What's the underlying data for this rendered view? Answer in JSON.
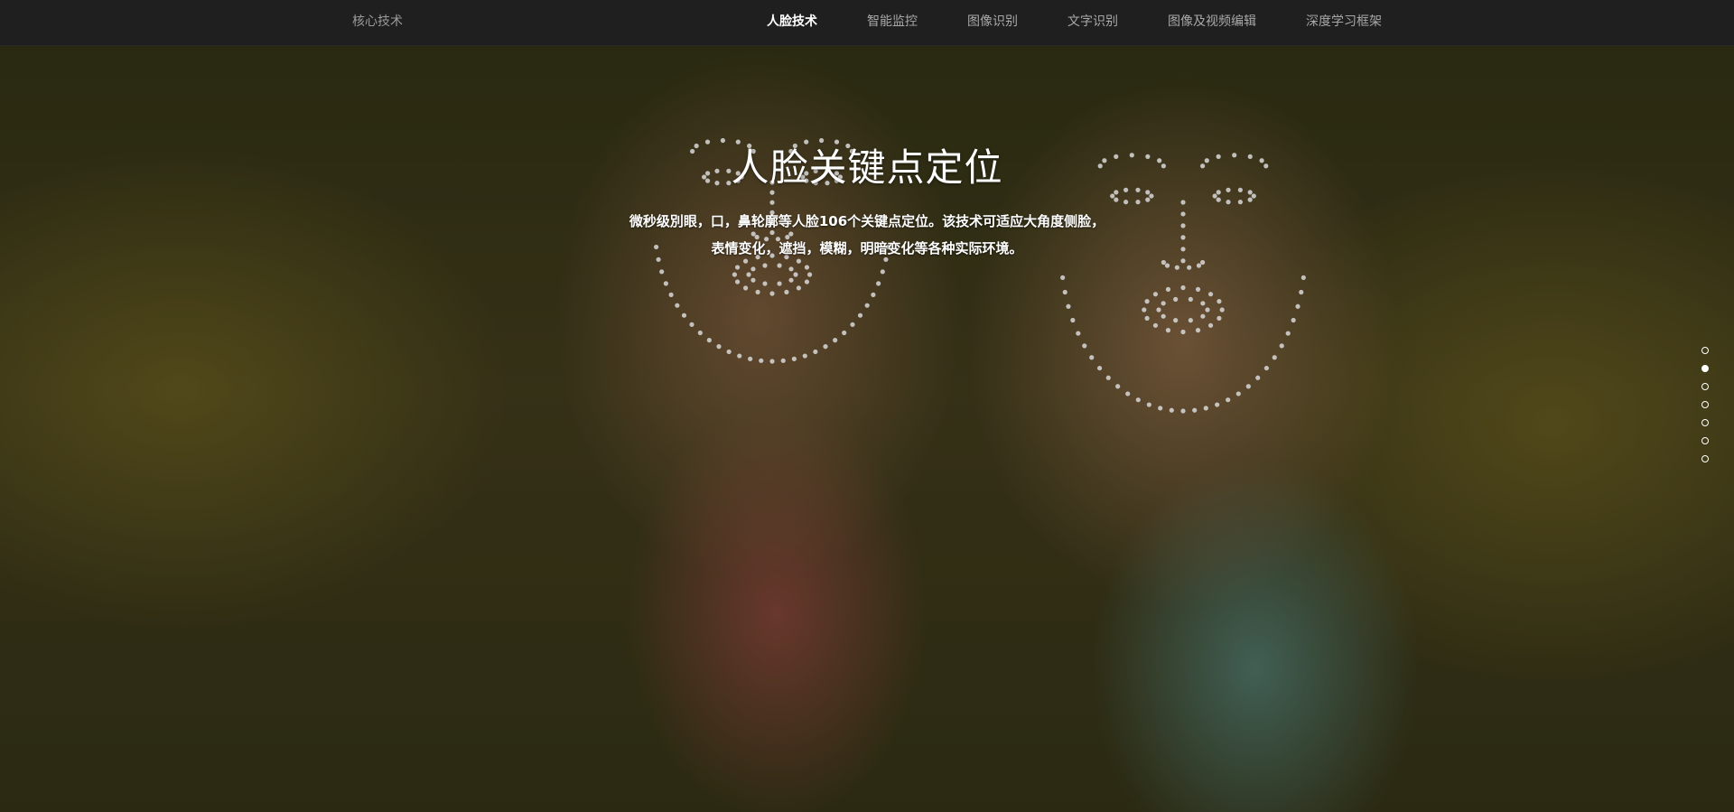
{
  "header": {
    "brand": "核心技术",
    "nav": [
      {
        "label": "人脸技术",
        "active": true
      },
      {
        "label": "智能监控",
        "active": false
      },
      {
        "label": "图像识别",
        "active": false
      },
      {
        "label": "文字识别",
        "active": false
      },
      {
        "label": "图像及视频编辑",
        "active": false
      },
      {
        "label": "深度学习框架",
        "active": false
      }
    ]
  },
  "hero": {
    "title": "人脸关键点定位",
    "description_line1": "微秒级別眼，口，鼻轮廓等人脸106个关键点定位。该技术可适应大角度侧脸，",
    "description_line2": "表情变化，遮挡，模糊，明暗变化等各种实际环境。"
  },
  "pager": {
    "count": 7,
    "active_index": 1
  },
  "colors": {
    "topbar_bg": "#1f1f1f",
    "nav_text": "#a8a8a8",
    "nav_active": "#ffffff",
    "landmark_dot": "#d8d8d8"
  }
}
